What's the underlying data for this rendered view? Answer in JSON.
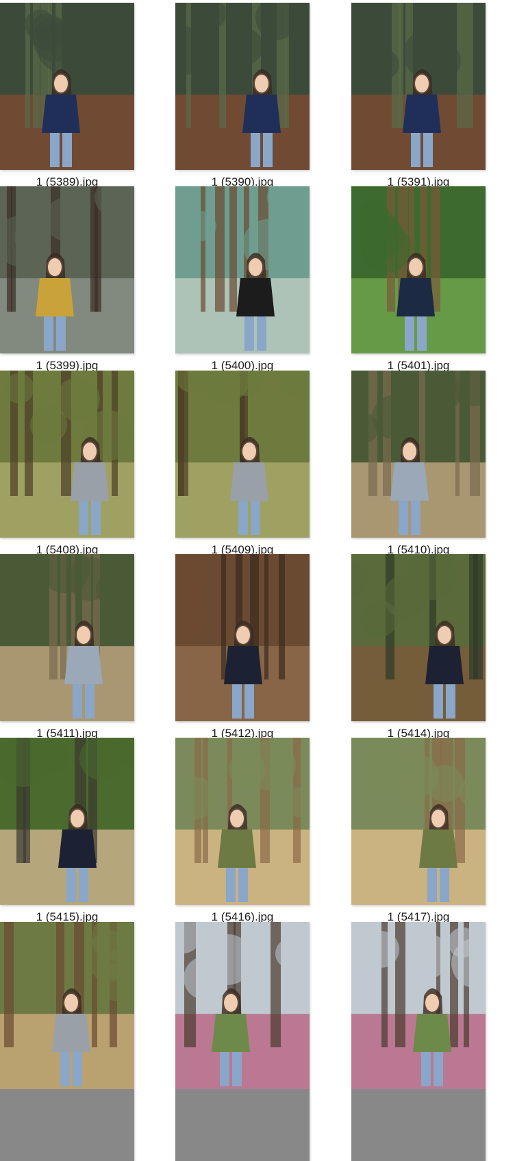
{
  "files": [
    {
      "name": "1 (5389).jpg",
      "scene": "bricks"
    },
    {
      "name": "1 (5390).jpg",
      "scene": "bricks"
    },
    {
      "name": "1 (5391).jpg",
      "scene": "bricks"
    },
    {
      "name": "1 (5399).jpg",
      "scene": "koala-photo"
    },
    {
      "name": "1 (5400).jpg",
      "scene": "koala-enclosure"
    },
    {
      "name": "1 (5401).jpg",
      "scene": "jungle"
    },
    {
      "name": "1 (5408).jpg",
      "scene": "forest"
    },
    {
      "name": "1 (5409).jpg",
      "scene": "forest"
    },
    {
      "name": "1 (5410).jpg",
      "scene": "waterfall"
    },
    {
      "name": "1 (5411).jpg",
      "scene": "waterfall"
    },
    {
      "name": "1 (5412).jpg",
      "scene": "ground"
    },
    {
      "name": "1 (5414).jpg",
      "scene": "park"
    },
    {
      "name": "1 (5415).jpg",
      "scene": "penguin"
    },
    {
      "name": "1 (5416).jpg",
      "scene": "kangaroo"
    },
    {
      "name": "1 (5417).jpg",
      "scene": "kangaroo"
    },
    {
      "name": "",
      "scene": "kangaroo-close"
    },
    {
      "name": "",
      "scene": "blossom"
    },
    {
      "name": "",
      "scene": "blossom"
    }
  ],
  "scene_palettes": {
    "bricks": [
      "#3c4a3a",
      "#7a4a34",
      "#5a6b48",
      "#1f2f5a"
    ],
    "koala-photo": [
      "#5b6455",
      "#8a8f86",
      "#3a2e26",
      "#c9a23a"
    ],
    "koala-enclosure": [
      "#6f9e90",
      "#b8c9c0",
      "#6b4a32",
      "#1c1c1c"
    ],
    "jungle": [
      "#3d6a2e",
      "#6fa24a",
      "#7a5a3a",
      "#1c2a44"
    ],
    "forest": [
      "#6e7a3e",
      "#a8a868",
      "#4c3d26",
      "#9aa0a8"
    ],
    "waterfall": [
      "#4a5a36",
      "#b8a27a",
      "#7a6a50",
      "#9aa8b8"
    ],
    "ground": [
      "#6b4a32",
      "#8c6a4a",
      "#3a2a1e",
      "#1c2233"
    ],
    "park": [
      "#5a6a3a",
      "#7a5a3a",
      "#2f3a2a",
      "#1c2233"
    ],
    "penguin": [
      "#4a6a2e",
      "#c8b08a",
      "#3a3a30",
      "#1c2233"
    ],
    "kangaroo": [
      "#7a8a5a",
      "#d8b888",
      "#8a6a48",
      "#6e7a44"
    ],
    "kangaroo-close": [
      "#6e7a44",
      "#c8a878",
      "#6a4a32",
      "#9aa0a8"
    ],
    "blossom": [
      "#c0c8d0",
      "#b86a88",
      "#4a3a2e",
      "#6e8a4a"
    ]
  }
}
